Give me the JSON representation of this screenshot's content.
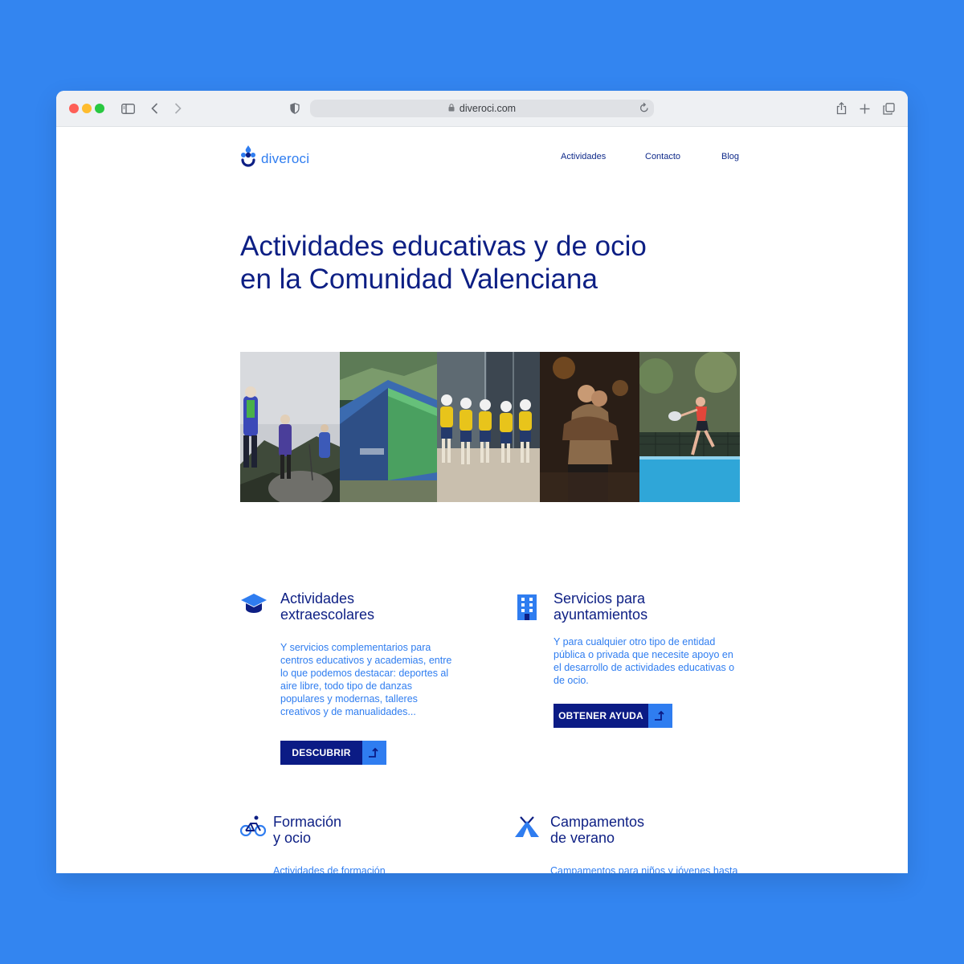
{
  "browser": {
    "url": "diveroci.com"
  },
  "site": {
    "logo_text": "diveroci",
    "nav": [
      "Actividades",
      "Contacto",
      "Blog"
    ]
  },
  "hero": {
    "title_line1": "Actividades educativas y de ocio",
    "title_line2": "en la Comunidad Valenciana"
  },
  "cards": [
    {
      "icon": "graduation-cap-icon",
      "title_line1": "Actividades",
      "title_line2": "extraescolares",
      "text": "Y servicios complementarios para centros educativos y academias, entre lo que podemos destacar: deportes al aire libre, todo tipo de danzas populares y modernas, talleres creativos y de manualidades...",
      "button": "DESCUBRIR"
    },
    {
      "icon": "building-icon",
      "title_line1": "Servicios para",
      "title_line2": "ayuntamientos",
      "text": "Y para cualquier otro tipo de entidad pública o privada que necesite apoyo en el desarrollo de actividades educativas o de ocio.",
      "button": "OBTENER AYUDA"
    },
    {
      "icon": "bicycle-icon",
      "title_line1": "Formación",
      "title_line2": "y ocio",
      "text": "Actividades de formación"
    },
    {
      "icon": "tent-icon",
      "title_line1": "Campamentos",
      "title_line2": "de verano",
      "text": "Campamentos para niños y jóvenes hasta"
    }
  ],
  "colors": {
    "background": "#3385f0",
    "navy": "#0d1f84",
    "accent": "#2f7df0"
  }
}
